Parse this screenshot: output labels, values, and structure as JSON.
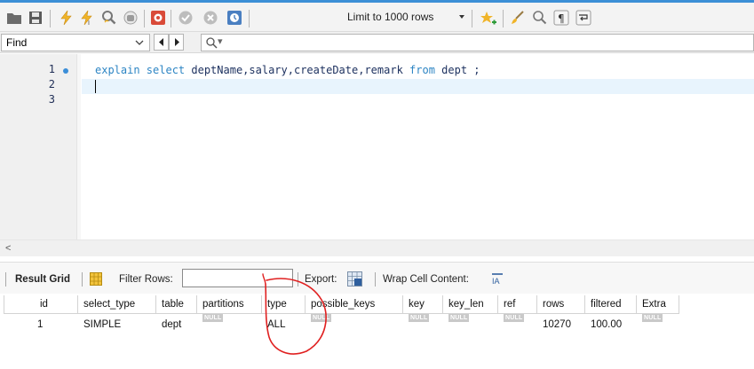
{
  "toolbar": {
    "limit_label": "Limit to 1000 rows",
    "accent_color": "#3c8fd6",
    "icons": [
      "folder-icon",
      "save-icon",
      "execute-icon",
      "execute-current-icon",
      "explain-icon",
      "stop-icon",
      "toggle-continue-icon",
      "commit-icon",
      "rollback-icon",
      "autocommit-icon",
      "beautify-icon",
      "bookmark-icon",
      "brush-icon",
      "find-icon",
      "invisibles-icon",
      "wrap-icon"
    ]
  },
  "find": {
    "mode_label": "Find",
    "search_value": ""
  },
  "editor": {
    "line_numbers": [
      "1",
      "2",
      "3"
    ],
    "code_kw1": "explain select",
    "code_cols": " deptName,salary,createDate,remark ",
    "code_kw2": "from",
    "code_tail": " dept ;"
  },
  "result_toolbar": {
    "result_grid_label": "Result Grid",
    "filter_rows_label": "Filter Rows:",
    "filter_value": "",
    "export_label": "Export:",
    "wrap_label": "Wrap Cell Content:"
  },
  "grid": {
    "columns": [
      "id",
      "select_type",
      "table",
      "partitions",
      "type",
      "possible_keys",
      "key",
      "key_len",
      "ref",
      "rows",
      "filtered",
      "Extra"
    ],
    "rows": [
      [
        "1",
        "SIMPLE",
        "dept",
        "NULL",
        "ALL",
        "NULL",
        "NULL",
        "NULL",
        "NULL",
        "10270",
        "100.00",
        "NULL"
      ]
    ]
  },
  "annotation_color": "#e02020"
}
